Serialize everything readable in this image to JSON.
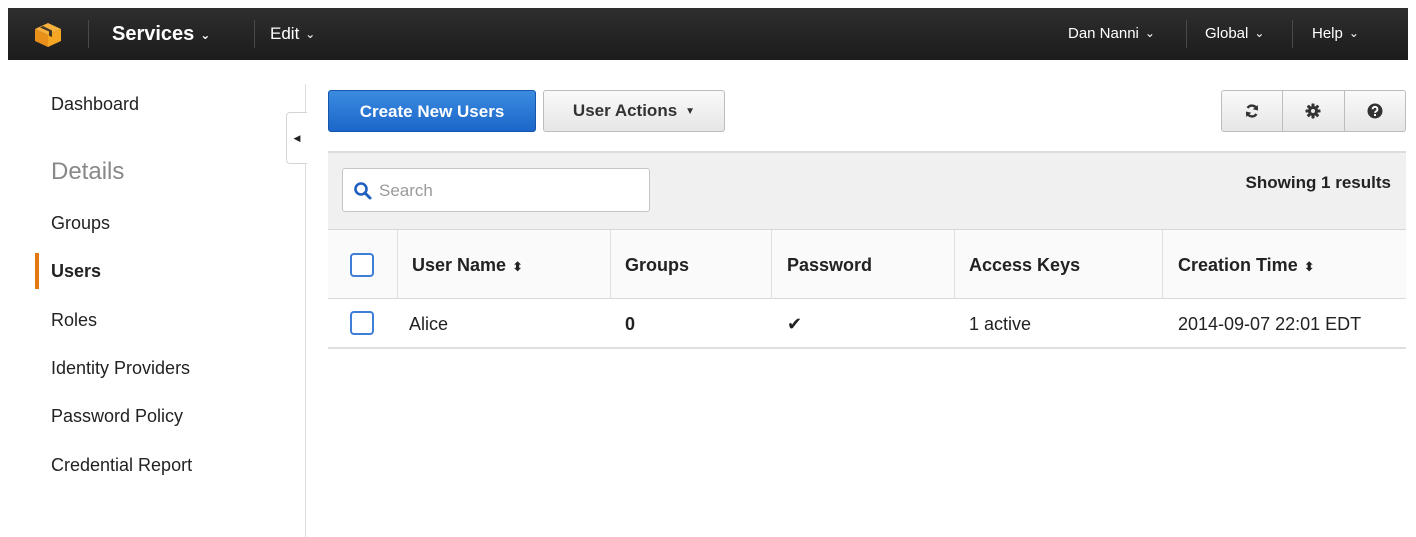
{
  "topbar": {
    "services_label": "Services",
    "edit_label": "Edit",
    "user_label": "Dan Nanni",
    "region_label": "Global",
    "help_label": "Help",
    "chevron": "⌄"
  },
  "sidebar": {
    "items": [
      {
        "label": "Dashboard"
      },
      {
        "label": "Details"
      },
      {
        "label": "Groups"
      },
      {
        "label": "Users"
      },
      {
        "label": "Roles"
      },
      {
        "label": "Identity Providers"
      },
      {
        "label": "Password Policy"
      },
      {
        "label": "Credential Report"
      }
    ],
    "active_item": "Users",
    "active_color": "#e47911"
  },
  "toolbar": {
    "create_label": "Create New Users",
    "actions_label": "User Actions",
    "icons": [
      "refresh-icon",
      "gear-icon",
      "help-circle-icon"
    ]
  },
  "search": {
    "placeholder": "Search",
    "value": ""
  },
  "results_text": "Showing 1 results",
  "table": {
    "headers": {
      "user_name": "User Name",
      "groups": "Groups",
      "password": "Password",
      "access_keys": "Access Keys",
      "creation_time": "Creation Time"
    },
    "sort_glyph": "⬍",
    "rows": [
      {
        "user_name": "Alice",
        "groups": "0",
        "password": "✔",
        "access_keys": "1 active",
        "creation_time": "2014-09-07 22:01 EDT"
      }
    ]
  },
  "colors": {
    "topbar_bg": "#232323",
    "primary_button": "#1f6fcf",
    "checkbox_border": "#3e7ed6",
    "logo_orange": "#f5a623"
  }
}
